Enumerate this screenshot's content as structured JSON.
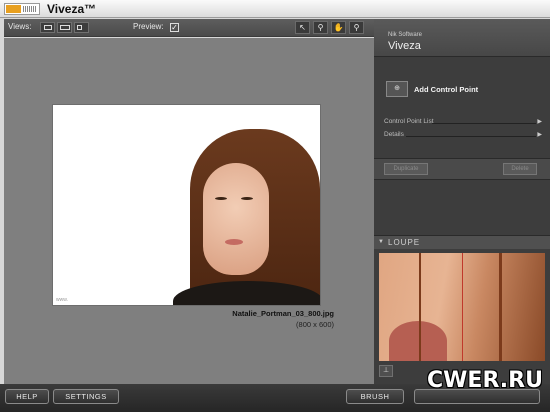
{
  "app": {
    "title": "Viveza™"
  },
  "toolbar": {
    "views_label": "Views:",
    "preview_label": "Preview:",
    "preview_checked": "✓",
    "view_modes": [
      "single-view-icon",
      "split-view-icon",
      "side-by-side-view-icon"
    ],
    "tools": [
      "pointer-tool-icon",
      "zoom-tool-icon",
      "hand-tool-icon",
      "control-point-tool-icon"
    ]
  },
  "image": {
    "file_name": "Natalie_Portman_03_800.jpg",
    "dimensions": "(800 x 600)"
  },
  "panel": {
    "vendor": "Nik Software",
    "product": "Viveza",
    "add_control_point": "Add Control Point",
    "sections": [
      "Control Point List",
      "Details"
    ],
    "duplicate_label": "Duplicate",
    "delete_label": "Delete",
    "loupe_label": "LOUPE"
  },
  "bottom": {
    "help": "HELP",
    "settings": "SETTINGS",
    "brush": "BRUSH"
  },
  "watermark": "CWER.RU"
}
